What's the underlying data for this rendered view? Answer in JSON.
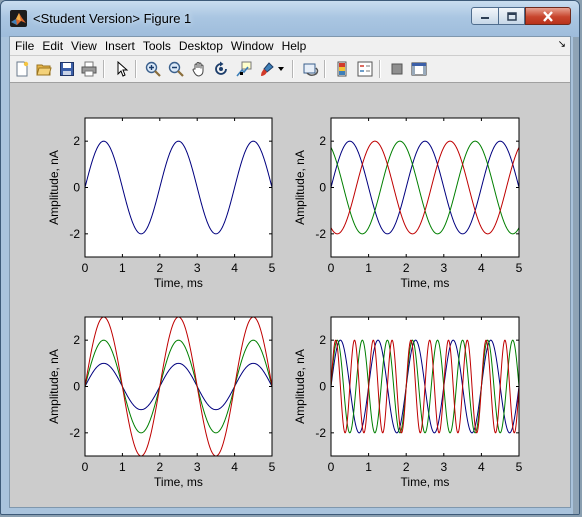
{
  "window": {
    "title": "<Student Version> Figure 1",
    "icons": {
      "app": "matlab-logo-icon",
      "minimize": "minimize-icon",
      "maximize": "maximize-icon",
      "close": "close-icon"
    }
  },
  "menu": {
    "items": [
      "File",
      "Edit",
      "View",
      "Insert",
      "Tools",
      "Desktop",
      "Window",
      "Help"
    ],
    "overflow_icon": "dock-arrow-icon"
  },
  "toolbar": {
    "buttons": [
      "new-figure-icon",
      "open-file-icon",
      "save-icon",
      "print-icon",
      "edit-plot-arrow-icon",
      "zoom-in-icon",
      "zoom-out-icon",
      "pan-hand-icon",
      "rotate-3d-icon",
      "data-cursor-icon",
      "brush-icon",
      "link-plot-icon",
      "colorbar-icon",
      "legend-icon",
      "hide-plot-tools-icon",
      "show-plot-tools-icon"
    ]
  },
  "colors": {
    "series1": "#00007f",
    "series2": "#007f00",
    "series3": "#bf0000",
    "figure_bg": "#cccccc"
  },
  "chart_data": [
    {
      "type": "line",
      "xlabel": "Time, ms",
      "ylabel": "Amplitude, nA",
      "xlim": [
        0,
        5
      ],
      "ylim": [
        -3,
        3
      ],
      "xticks": [
        "0",
        "1",
        "2",
        "3",
        "4",
        "5"
      ],
      "yticks": [
        "-2",
        "0",
        "2"
      ],
      "series": [
        {
          "color": "#00007f",
          "amplitude": 2,
          "frequency_per_ms": 0.5,
          "phase_deg": 0
        }
      ]
    },
    {
      "type": "line",
      "xlabel": "Time, ms",
      "ylabel": "Amplitude, nA",
      "xlim": [
        0,
        5
      ],
      "ylim": [
        -3,
        3
      ],
      "xticks": [
        "0",
        "1",
        "2",
        "3",
        "4",
        "5"
      ],
      "yticks": [
        "-2",
        "0",
        "2"
      ],
      "series": [
        {
          "color": "#00007f",
          "amplitude": 2,
          "frequency_per_ms": 0.5,
          "phase_deg": 0
        },
        {
          "color": "#007f00",
          "amplitude": 2,
          "frequency_per_ms": 0.5,
          "phase_deg": 120
        },
        {
          "color": "#bf0000",
          "amplitude": 2,
          "frequency_per_ms": 0.5,
          "phase_deg": 240
        }
      ]
    },
    {
      "type": "line",
      "xlabel": "Time, ms",
      "ylabel": "Amplitude, nA",
      "xlim": [
        0,
        5
      ],
      "ylim": [
        -3,
        3
      ],
      "xticks": [
        "0",
        "1",
        "2",
        "3",
        "4",
        "5"
      ],
      "yticks": [
        "-2",
        "0",
        "2"
      ],
      "series": [
        {
          "color": "#00007f",
          "amplitude": 1,
          "frequency_per_ms": 0.5,
          "phase_deg": 0
        },
        {
          "color": "#007f00",
          "amplitude": 2,
          "frequency_per_ms": 0.5,
          "phase_deg": 0
        },
        {
          "color": "#bf0000",
          "amplitude": 3,
          "frequency_per_ms": 0.5,
          "phase_deg": 0
        }
      ]
    },
    {
      "type": "line",
      "xlabel": "Time, ms",
      "ylabel": "Amplitude, nA",
      "xlim": [
        0,
        5
      ],
      "ylim": [
        -3,
        3
      ],
      "xticks": [
        "0",
        "1",
        "2",
        "3",
        "4",
        "5"
      ],
      "yticks": [
        "-2",
        "0",
        "2"
      ],
      "series": [
        {
          "color": "#00007f",
          "amplitude": 2,
          "frequency_per_ms": 1,
          "phase_deg": 0
        },
        {
          "color": "#007f00",
          "amplitude": 2,
          "frequency_per_ms": 1.5,
          "phase_deg": 0
        },
        {
          "color": "#bf0000",
          "amplitude": 2,
          "frequency_per_ms": 2,
          "phase_deg": 0
        }
      ]
    }
  ]
}
